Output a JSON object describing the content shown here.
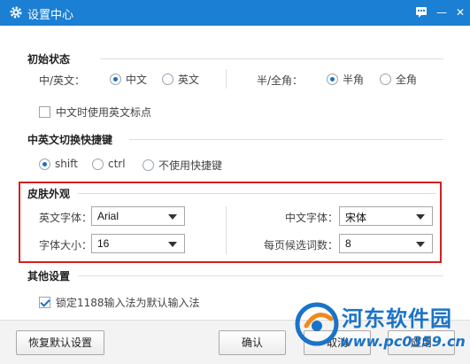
{
  "window": {
    "title": "设置中心",
    "accent": "#1b7fd4"
  },
  "titlebar": {
    "help_icon": "chat-icon",
    "min_icon": "minimize-icon",
    "close_icon": "close-icon",
    "min_label": "—",
    "close_label": "✕"
  },
  "initial_state": {
    "title": "初始状态",
    "cn_en_label": "中/英文：",
    "cn_en_options": [
      "中文",
      "英文"
    ],
    "cn_en_selected": "中文",
    "width_label": "半/全角：",
    "width_options": [
      "半角",
      "全角"
    ],
    "width_selected": "半角",
    "punct_checkbox": "中文时使用英文标点",
    "punct_checked": false
  },
  "switch_key": {
    "title": "中英文切换快捷键",
    "options": [
      "shift",
      "ctrl",
      "不使用快捷键"
    ],
    "selected": "shift"
  },
  "skin": {
    "title": "皮肤外观",
    "en_font_label": "英文字体：",
    "en_font_value": "Arial",
    "cn_font_label": "中文字体：",
    "cn_font_value": "宋体",
    "font_size_label": "字体大小：",
    "font_size_value": "16",
    "candidates_label": "每页候选词数：",
    "candidates_value": "8",
    "highlight_color": "#d42020"
  },
  "other": {
    "title": "其他设置",
    "default_ime_checkbox": "锁定1188输入法为默认输入法",
    "default_ime_checked": true
  },
  "footer": {
    "restore_label": "恢复默认设置",
    "ok_label": "确认",
    "cancel_label": "取消",
    "apply_label": "应用"
  },
  "watermark": {
    "line1": "河东软件园",
    "line2": "www.pc0359.cn"
  }
}
